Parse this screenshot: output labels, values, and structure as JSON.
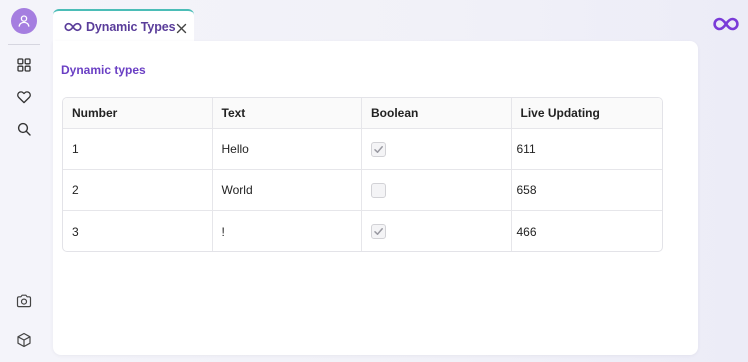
{
  "tab": {
    "label": "Dynamic Types"
  },
  "section": {
    "title": "Dynamic types"
  },
  "table": {
    "headers": [
      "Number",
      "Text",
      "Boolean",
      "Live Updating"
    ],
    "rows": [
      {
        "number": "1",
        "text": "Hello",
        "boolean": true,
        "live": "611"
      },
      {
        "number": "2",
        "text": "World",
        "boolean": false,
        "live": "658"
      },
      {
        "number": "3",
        "text": "!",
        "boolean": true,
        "live": "466"
      }
    ]
  },
  "icons": {
    "sidebar_top": [
      "user-icon",
      "dashboard-grid-icon",
      "heart-icon",
      "search-icon"
    ],
    "sidebar_bottom": [
      "camera-icon",
      "cube-icon"
    ],
    "tab": "infinity-icon",
    "brand": "infinity-logo-icon"
  },
  "colors": {
    "accent_purple": "#6a3fc4",
    "avatar": "#a57ee0",
    "tab_border": "#4bbdb7"
  }
}
